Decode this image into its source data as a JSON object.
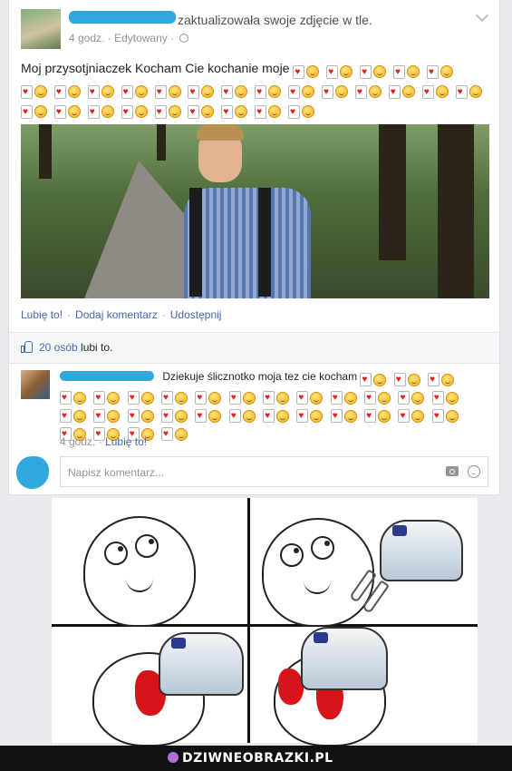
{
  "post": {
    "header_action": "zaktualizowała swoje zdjęcie w tle.",
    "time": "4 godz.",
    "edited_label": "Edytowany",
    "separator": "·",
    "status_text": "Moj przysotjniaczek Kocham Cie kochanie moje",
    "status_emoticon_count": 28,
    "actions": {
      "like": "Lubię to!",
      "comment": "Dodaj komentarz",
      "share": "Udostępnij"
    },
    "likes": {
      "count_link": "20 osób",
      "suffix": "lubi to."
    },
    "comment": {
      "text": "Dziekuje ślicznotko moja tez cie kocham",
      "emoticon_count": 31,
      "time": "4 godz.",
      "like_label": "Lubię to!"
    },
    "compose": {
      "placeholder": "Napisz komentarz..."
    }
  },
  "icons": {
    "audience": "globe-icon",
    "menu": "chevron-down-icon",
    "like": "thumbs-up-icon",
    "camera": "camera-icon",
    "emoji": "emoji-icon"
  },
  "footer": {
    "brand": "DZIWNEOBRAZKI.PL"
  },
  "colors": {
    "link": "#4267b2",
    "scribble": "#31a8dd",
    "footer_bg": "#111111"
  }
}
